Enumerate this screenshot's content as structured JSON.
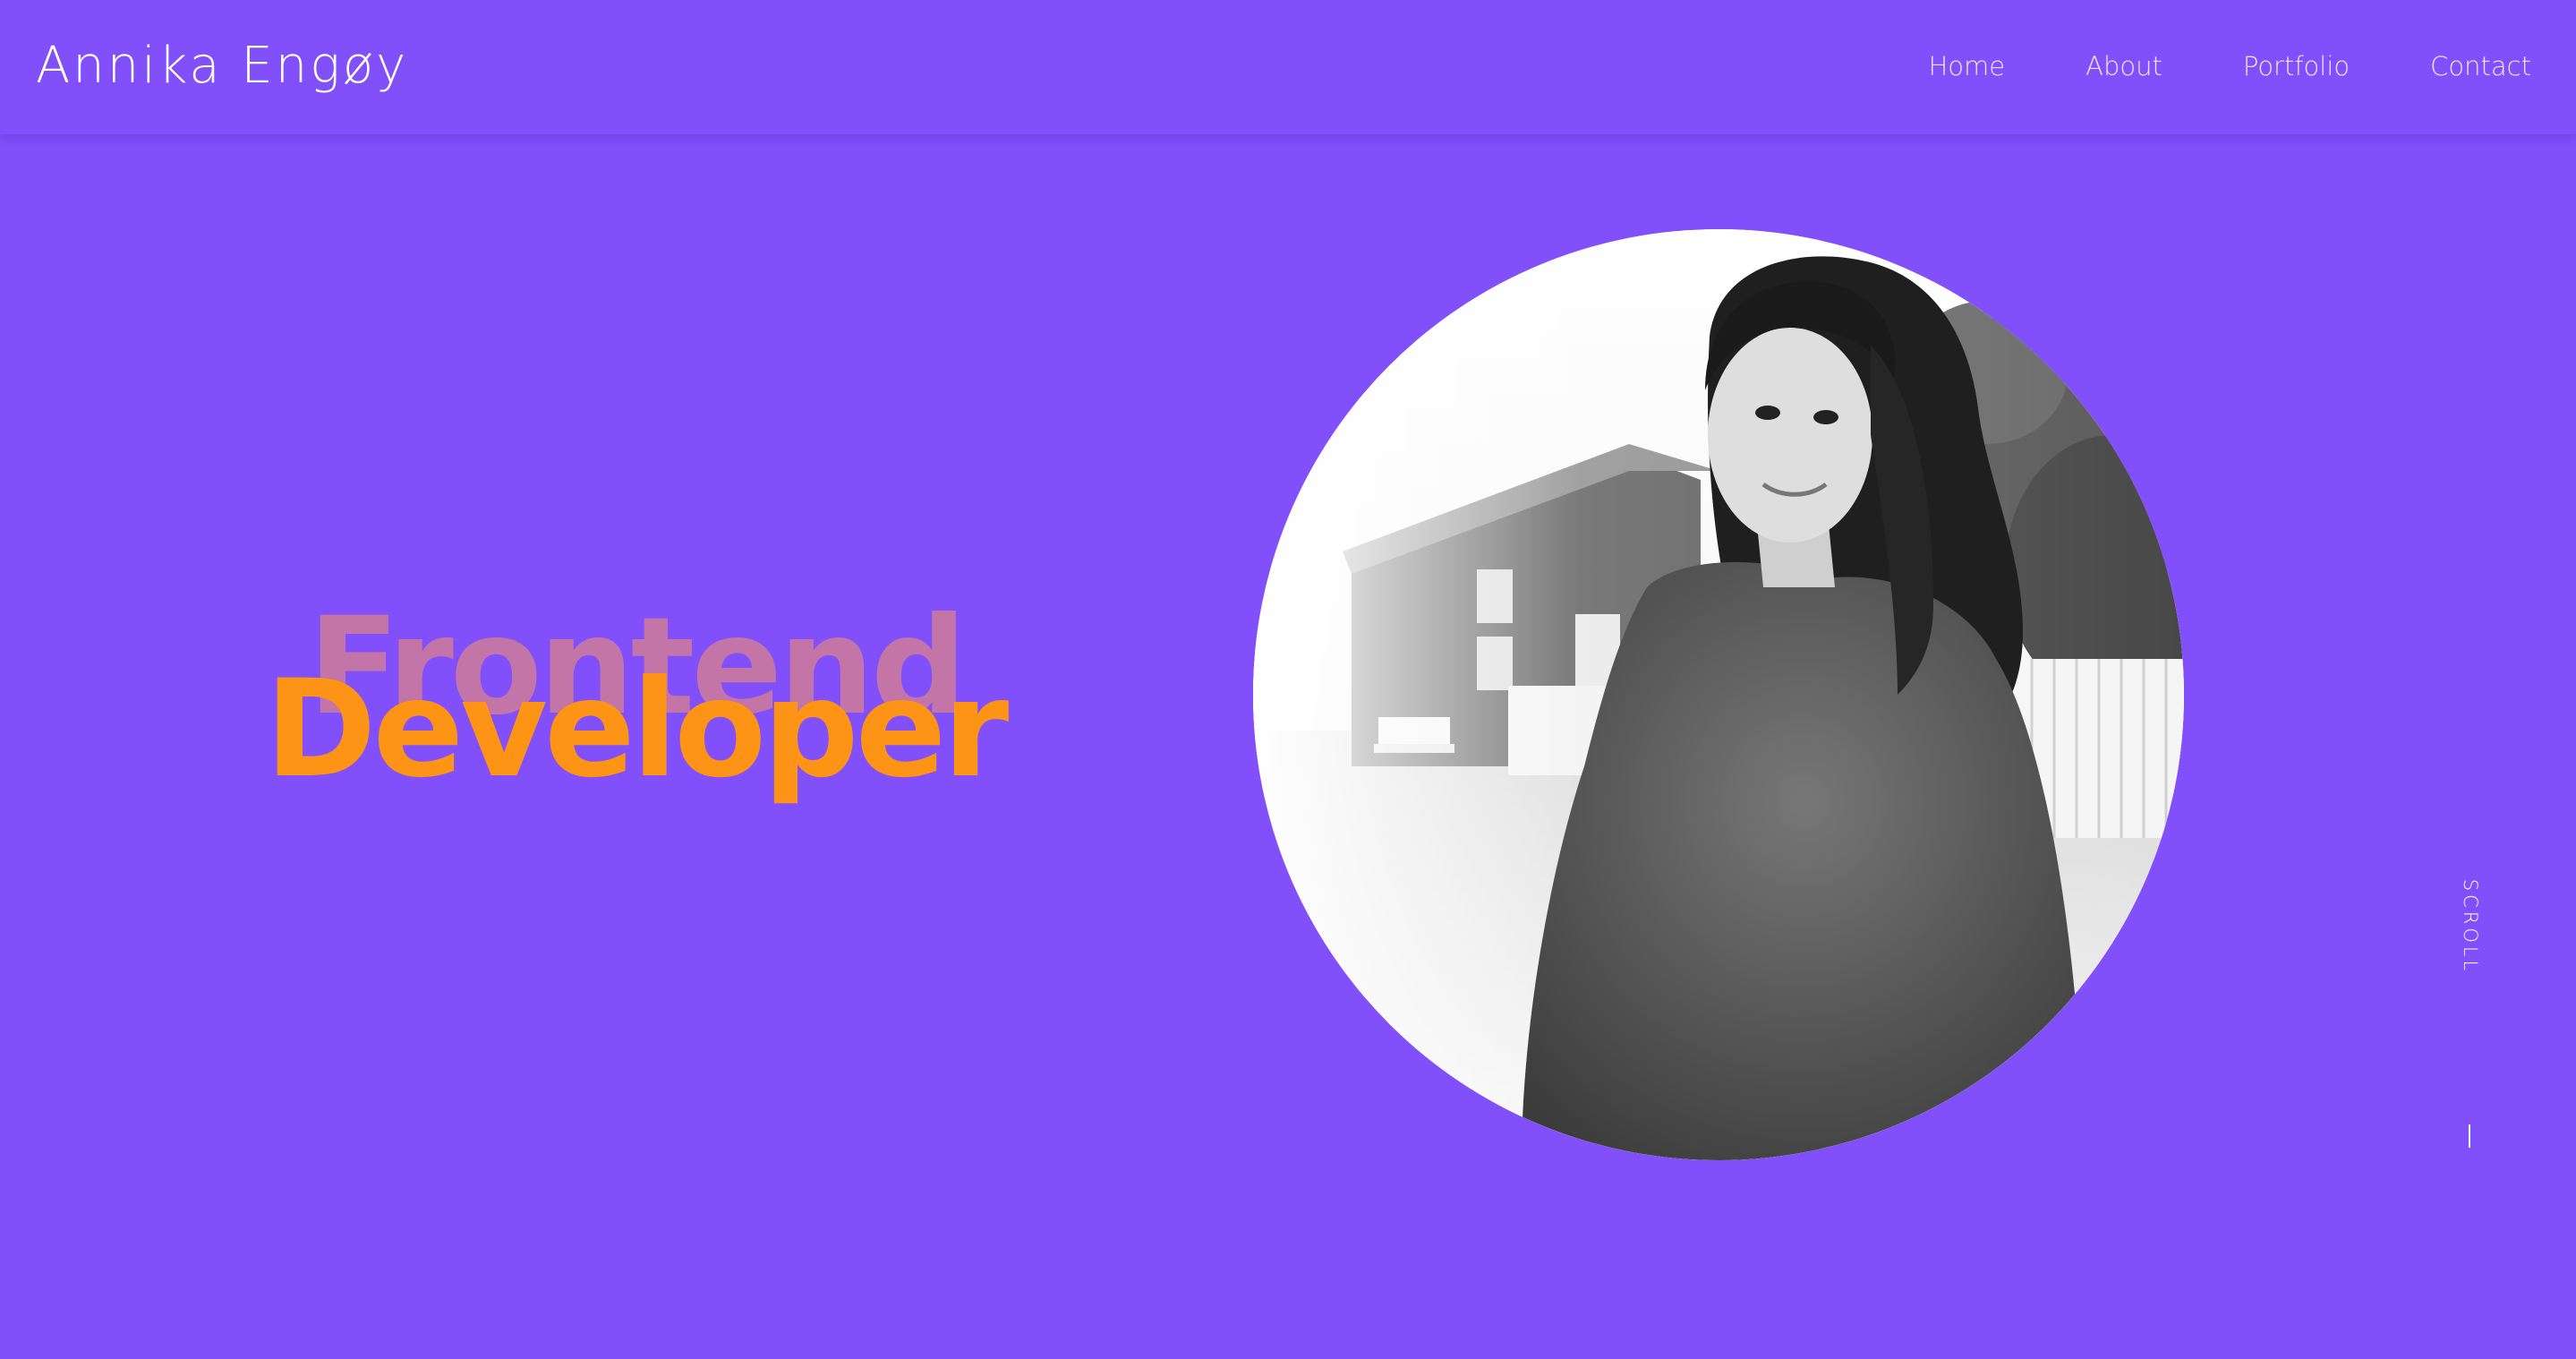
{
  "header": {
    "brand": "Annika Engøy",
    "nav": [
      "Home",
      "About",
      "Portfolio",
      "Contact"
    ]
  },
  "hero": {
    "word_back": "Frontend",
    "word_front": "Developer"
  },
  "scroll": {
    "label": "SCROLL"
  },
  "colors": {
    "background": "#8150fa",
    "accent_orange": "#fe9415",
    "accent_pink": "#c475a8",
    "nav_text": "#eee6ff"
  }
}
